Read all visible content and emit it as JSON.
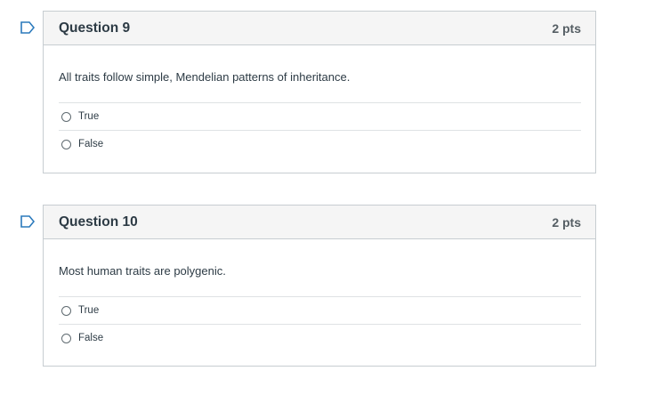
{
  "questions": [
    {
      "title": "Question 9",
      "points": "2 pts",
      "text": "All traits follow simple, Mendelian patterns of inheritance.",
      "answers": [
        "True",
        "False"
      ]
    },
    {
      "title": "Question 10",
      "points": "2 pts",
      "text": "Most human traits are polygenic.",
      "answers": [
        "True",
        "False"
      ]
    }
  ],
  "colors": {
    "flag": "#2b7abc",
    "header_bg": "#f5f5f5",
    "border": "#c7cdd1",
    "text": "#2d3b45"
  }
}
